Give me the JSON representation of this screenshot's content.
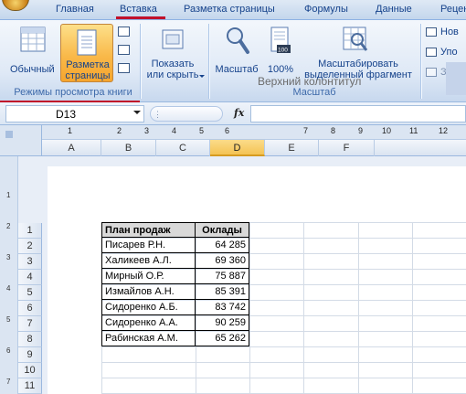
{
  "tabs": [
    "Главная",
    "Вставка",
    "Разметка страницы",
    "Формулы",
    "Данные",
    "Рецен"
  ],
  "ribbon": {
    "btn_normal": "Обычный",
    "btn_page_layout_1": "Разметка",
    "btn_page_layout_2": "страницы",
    "btn_show_hide_1": "Показать",
    "btn_show_hide_2": "или скрыть",
    "btn_zoom": "Масштаб",
    "btn_zoom100": "100%",
    "btn_zoom100_icon": "100",
    "btn_zoom_sel_1": "Масштабировать",
    "btn_zoom_sel_2": "выделенный фрагмент",
    "btn_new": "Нов",
    "btn_arrange": "Упо",
    "btn_freeze": "Закр",
    "group_views": "Режимы просмотра книги",
    "group_zoom": "Масштаб"
  },
  "formula_bar": {
    "name_box": "D13",
    "fx": "fx",
    "value": ""
  },
  "ruler_numbers": [
    "1",
    "2",
    "3",
    "4",
    "5",
    "6",
    "7",
    "8",
    "9",
    "10",
    "11",
    "12"
  ],
  "vruler_numbers": [
    "1",
    "2",
    "3",
    "4",
    "5",
    "6",
    "7"
  ],
  "columns": [
    "A",
    "B",
    "C",
    "D",
    "E",
    "F"
  ],
  "selected_column": "D",
  "header_text": "Верхний колонтитул",
  "rows": [
    "1",
    "2",
    "3",
    "4",
    "5",
    "6",
    "7",
    "8",
    "9",
    "10",
    "11"
  ],
  "table": {
    "headers": [
      "План продаж",
      "Оклады"
    ],
    "data": [
      [
        "Писарев Р.Н.",
        "64 285"
      ],
      [
        "Халикеев А.Л.",
        "69 360"
      ],
      [
        "Мирный О.Р.",
        "75 887"
      ],
      [
        "Измайлов А.Н.",
        "85 391"
      ],
      [
        "Сидоренко А.Б.",
        "83 742"
      ],
      [
        "Сидоренко А.А.",
        "90 259"
      ],
      [
        "Рабинская А.М.",
        "65 262"
      ]
    ]
  },
  "accent_colors": {
    "highlight_underline": "#c0102a",
    "active_button": "#f9b94a",
    "selected_column": "#f4c354"
  }
}
